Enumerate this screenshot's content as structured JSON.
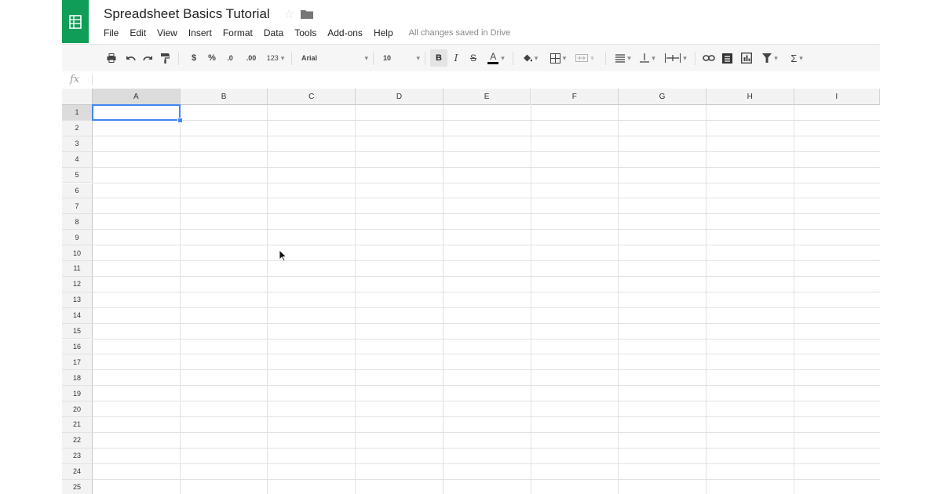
{
  "document": {
    "title": "Spreadsheet Basics Tutorial",
    "saved_status": "All changes saved in Drive"
  },
  "menu": [
    "File",
    "Edit",
    "View",
    "Insert",
    "Format",
    "Data",
    "Tools",
    "Add-ons",
    "Help"
  ],
  "toolbar": {
    "currency_label": "$",
    "percent_label": "%",
    "decrease_decimal_label": ".0",
    "increase_decimal_label": ".00",
    "more_formats_label": "123",
    "font_name": "Arial",
    "font_size": "10",
    "bold_label": "B",
    "italic_label": "I",
    "strikethrough_label": "S",
    "text_color_label": "A",
    "sum_label": "Σ"
  },
  "formula_bar": {
    "fx_label": "fx",
    "value": ""
  },
  "sheet": {
    "columns": [
      "A",
      "B",
      "C",
      "D",
      "E",
      "F",
      "G",
      "H",
      "I"
    ],
    "rows": [
      "1",
      "2",
      "3",
      "4",
      "5",
      "6",
      "7",
      "8",
      "9",
      "10",
      "11",
      "12",
      "13",
      "14",
      "15",
      "16",
      "17",
      "18",
      "19",
      "20",
      "21",
      "22",
      "23",
      "24",
      "25"
    ],
    "selected_cell": "A1"
  },
  "icons": {
    "logo": "sheets-logo-icon",
    "star": "star-icon",
    "folder": "folder-icon",
    "print": "print-icon",
    "undo": "undo-icon",
    "redo": "redo-icon",
    "paint_format": "paint-format-icon",
    "fill_color": "fill-color-icon",
    "borders": "borders-icon",
    "merge": "merge-cells-icon",
    "align": "horizontal-align-icon",
    "valign": "vertical-align-icon",
    "wrap": "text-wrap-icon",
    "link": "link-icon",
    "comment": "comment-icon",
    "chart": "chart-icon",
    "filter": "filter-icon"
  },
  "colors": {
    "brand_green": "#0f9d58",
    "selection_blue": "#4285f4"
  }
}
